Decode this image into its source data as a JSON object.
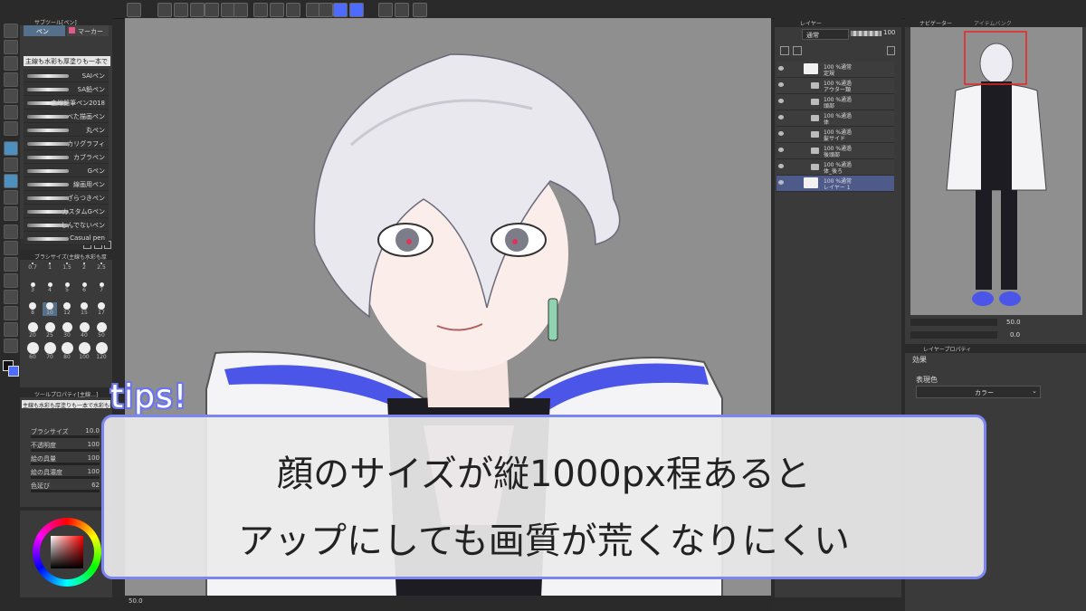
{
  "tips_label": "tips!",
  "caption": {
    "line1": "顔のサイズが縦1000px程あると",
    "line2": "アップにしても画質が荒くなりにくい"
  },
  "colors": {
    "accent_blue": "#4d6bff",
    "caption_border": "#7c86f2",
    "caption_bg": "#ebebeb",
    "canvas_gray": "#8f8f8f",
    "panel": "#3a3a3a"
  },
  "subtool_panel": {
    "tab": "サブツール[ペン]",
    "pen_tab": "ペン",
    "marker_tab": "マーカー",
    "selected_brush": "主線も水彩も厚塗りも一本で",
    "brushes": [
      "SAIペン",
      "SA鉛ペン",
      "主線鉛筆ペン2018",
      "べた描画ペン",
      "丸ペン",
      "カリグラフィ",
      "カブラペン",
      "Gペン",
      "線画用ペン",
      "ざらつきペン",
      "カスタムGペン",
      "しんでないペン",
      "Casual pen"
    ]
  },
  "brush_size_panel": {
    "title": "ブラシサイズ(主線も水彩も厚",
    "sizes": [
      "0.7",
      "1",
      "1.5",
      "2",
      "2.5",
      "3",
      "4",
      "5",
      "6",
      "7",
      "8",
      "10",
      "12",
      "15",
      "17",
      "20",
      "25",
      "30",
      "40",
      "50",
      "60",
      "70",
      "80",
      "100",
      "120"
    ]
  },
  "tool_property": {
    "title": "ツールプロパティ[主線…]",
    "brush_name": "主線も水彩も厚塗りも一本で水彩も描ける",
    "rows": [
      {
        "label": "ブラシサイズ",
        "value": "10.0"
      },
      {
        "label": "不透明度",
        "value": "100"
      },
      {
        "label": "絵の具量",
        "value": "100"
      },
      {
        "label": "絵の具濃度",
        "value": "100"
      },
      {
        "label": "色延び",
        "value": "62"
      }
    ]
  },
  "layer_panel": {
    "tab": "レイヤー",
    "blend_mode": "通常",
    "opacity": "100",
    "layers": [
      {
        "line1": "100 %通常",
        "line2": "定規",
        "type": "ruler"
      },
      {
        "line1": "100 %通過",
        "line2": "アウター類",
        "type": "folder"
      },
      {
        "line1": "100 %通過",
        "line2": "頭部",
        "type": "folder"
      },
      {
        "line1": "100 %通過",
        "line2": "体",
        "type": "folder"
      },
      {
        "line1": "100 %通過",
        "line2": "髪サイド",
        "type": "folder"
      },
      {
        "line1": "100 %通過",
        "line2": "後頭部",
        "type": "folder"
      },
      {
        "line1": "100 %通過",
        "line2": "体_後ろ",
        "type": "folder"
      },
      {
        "line1": "100 %通常",
        "line2": "レイヤー 1",
        "type": "raster"
      }
    ]
  },
  "navigator": {
    "tab": "ナビゲーター",
    "tab2": "アイテムバンク",
    "zoom": "50.0",
    "rotation": "0.0"
  },
  "layer_property": {
    "tab": "レイヤープロパティ",
    "effect_label": "効果",
    "expression_label": "表現色",
    "expression_value": "カラー"
  },
  "statusbar": {
    "zoom": "50.0"
  }
}
